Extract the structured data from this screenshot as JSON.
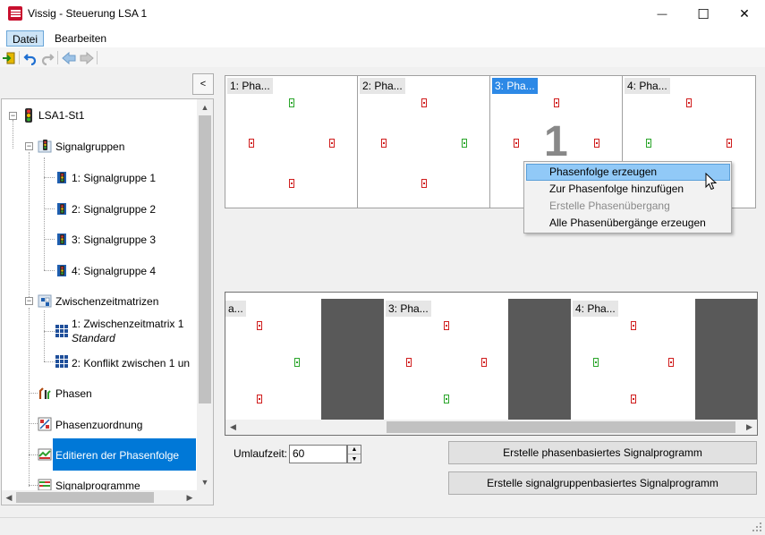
{
  "window": {
    "title": "Vissig - Steuerung LSA 1",
    "minimize": "—",
    "maximize": "☐",
    "close": "✕"
  },
  "menu": {
    "items": [
      {
        "label": "Datei"
      },
      {
        "label": "Bearbeiten"
      }
    ]
  },
  "toolbar": {
    "icons": [
      "exit-icon",
      "undo-icon",
      "redo-icon",
      "back-arrow-icon",
      "forward-arrow-icon"
    ]
  },
  "left_panel": {
    "collapse_label": "<",
    "tree": {
      "root": "LSA1-St1",
      "signalgruppen": {
        "label": "Signalgruppen",
        "items": [
          "1: Signalgruppe 1",
          "2: Signalgruppe 2",
          "3: Signalgruppe 3",
          "4: Signalgruppe 4"
        ]
      },
      "zwischenzeitmatrizen": {
        "label": "Zwischenzeitmatrizen",
        "item1": "1: Zwischenzeitmatrix 1",
        "item1_sub": "Standard",
        "item2": "2: Konflikt zwischen 1 un"
      },
      "phasen": "Phasen",
      "phasenzuordnung": "Phasenzuordnung",
      "editieren": "Editieren der Phasenfolge",
      "signalprogramme": "Signalprogramme"
    }
  },
  "phases": {
    "cards": [
      {
        "label": "1: Pha..."
      },
      {
        "label": "2: Pha..."
      },
      {
        "label": "3: Pha..."
      },
      {
        "label": "4: Pha..."
      }
    ],
    "selected_number": "1"
  },
  "context_menu": {
    "items": [
      {
        "label": "Phasenfolge erzeugen",
        "state": "highlighted"
      },
      {
        "label": "Zur Phasenfolge hinzufügen",
        "state": "normal"
      },
      {
        "label": "Erstelle Phasenübergang",
        "state": "disabled"
      },
      {
        "label": "Alle Phasenübergänge erzeugen",
        "state": "normal"
      }
    ]
  },
  "sequence": {
    "labels": [
      "a...",
      "3: Pha...",
      "4: Pha..."
    ]
  },
  "controls": {
    "umlaufzeit_label": "Umlaufzeit:",
    "umlaufzeit_value": "60",
    "btn_phasen": "Erstelle phasenbasiertes Signalprogramm",
    "btn_signalgruppen": "Erstelle signalgruppenbasiertes Signalprogramm"
  },
  "colors": {
    "selection": "#0078d7",
    "signal_red": "#d01d1d",
    "signal_green": "#2aa52a",
    "gap": "#595959"
  }
}
